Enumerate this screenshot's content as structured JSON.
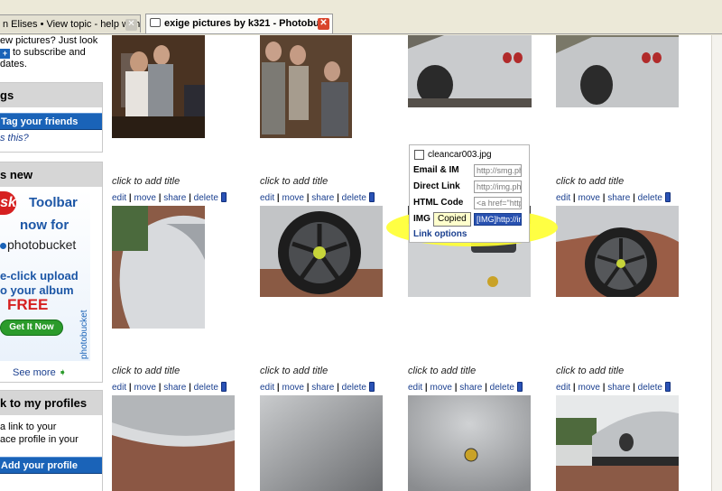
{
  "tabs": [
    {
      "label": "n Elises • View topic - help wanted",
      "active": false
    },
    {
      "label": "exige pictures by k321 - Photobu...",
      "active": true
    }
  ],
  "sidebar": {
    "subscribe_line1": "ew pictures? Just look",
    "subscribe_line2": "to subscribe and",
    "subscribe_line3": "dates.",
    "tag_head": "gs",
    "tag_button": "Tag your friends",
    "tag_link": "s this?",
    "news_head": "s new",
    "ad_brand": "sk",
    "ad_toolbar": "Toolbar",
    "ad_now_for": "now for",
    "ad_photobucket": "photobucket",
    "ad_oneclick": "e-click upload",
    "ad_album": "o your album",
    "ad_free": "FREE",
    "ad_getit": "Get It Now",
    "ad_side": "photobucket",
    "see_more": "See more",
    "profiles_head": "k to my profiles",
    "profiles_text1": "a link to your",
    "profiles_text2": "ace profile in your",
    "add_profile": "Add your profile"
  },
  "thumb_title": "click to add title",
  "actions": {
    "edit": "edit",
    "move": "move",
    "share": "share",
    "delete": "delete",
    "sep": " | "
  },
  "popup": {
    "filename": "cleancar003.jpg",
    "email_label": "Email & IM",
    "email_value": "http://smg.pho",
    "direct_label": "Direct Link",
    "direct_value": "http://img.pho",
    "html_label": "HTML Code",
    "html_value": "<a href=\"http",
    "img_label": "IMG",
    "img_value": "[IMG]http://im",
    "copied": "Copied",
    "link_options": "Link options"
  },
  "colors": {
    "accent_blue": "#1a63b8",
    "highlight": "#ffff33",
    "link": "#1a3f8f"
  }
}
